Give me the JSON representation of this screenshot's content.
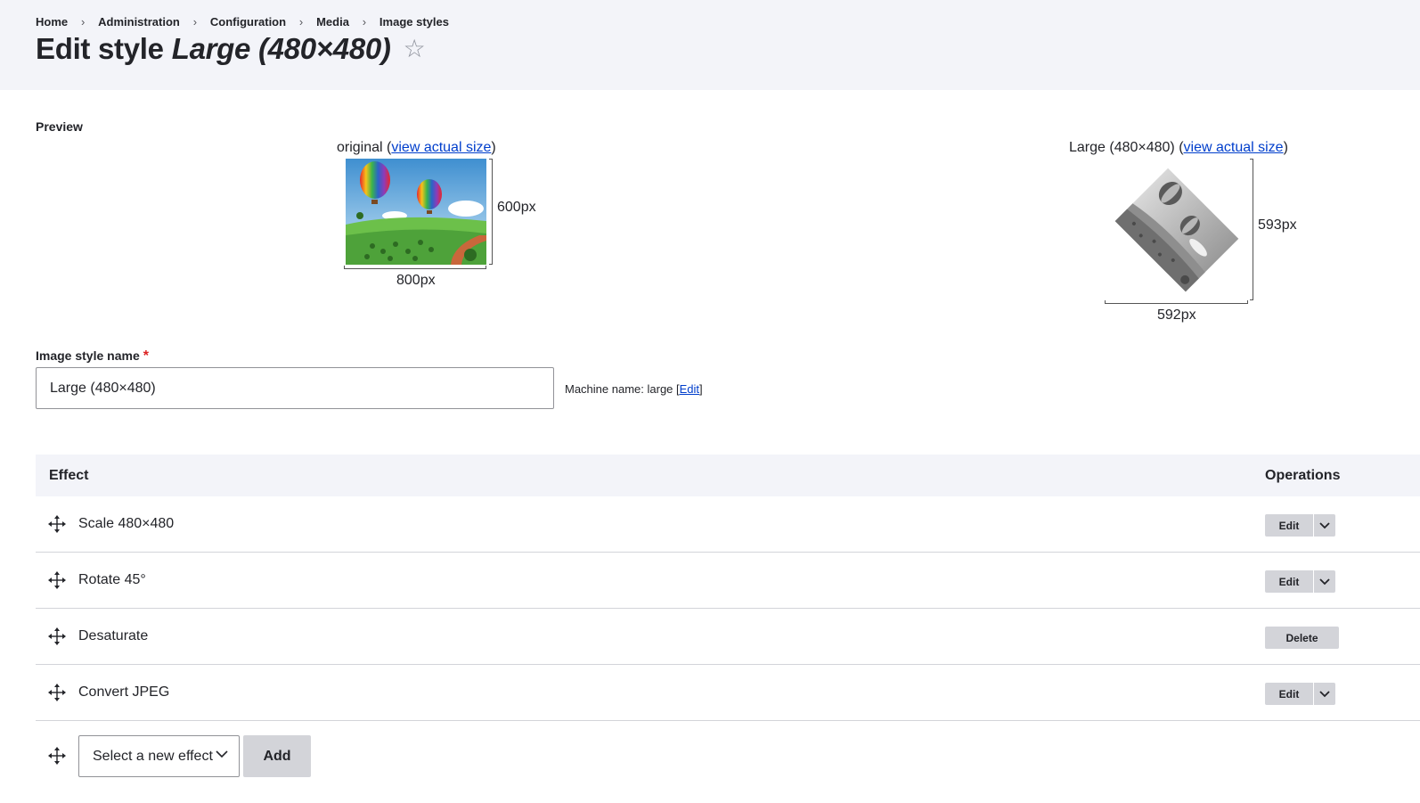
{
  "breadcrumb": [
    "Home",
    "Administration",
    "Configuration",
    "Media",
    "Image styles"
  ],
  "title": {
    "prefix": "Edit style",
    "name": "Large (480×480)",
    "star": "☆"
  },
  "preview": {
    "label": "Preview",
    "original": {
      "caption": "original (",
      "link": "view actual size",
      "close": ")",
      "width_label": "800px",
      "height_label": "600px"
    },
    "derived": {
      "caption": "Large (480×480) (",
      "link": "view actual size",
      "close": ")",
      "width_label": "592px",
      "height_label": "593px"
    }
  },
  "form": {
    "name_label": "Image style name",
    "required_mark": "*",
    "name_value": "Large (480×480)",
    "machine_name_prefix": "Machine name: large [",
    "machine_name_edit": "Edit",
    "machine_name_suffix": "]"
  },
  "table": {
    "col_effect": "Effect",
    "col_operations": "Operations",
    "rows": [
      {
        "name": "Scale 480×480",
        "op": "Edit",
        "has_dropdown": true
      },
      {
        "name": "Rotate 45°",
        "op": "Edit",
        "has_dropdown": true
      },
      {
        "name": "Desaturate",
        "op": "Delete",
        "has_dropdown": false
      },
      {
        "name": "Convert JPEG",
        "op": "Edit",
        "has_dropdown": true
      }
    ],
    "add_select_placeholder": "Select a new effect",
    "add_button": "Add"
  },
  "colors": {
    "header_bg": "#f3f4f9",
    "link": "#003ecc",
    "button_bg": "#d3d4d9",
    "required": "#dc2323"
  }
}
